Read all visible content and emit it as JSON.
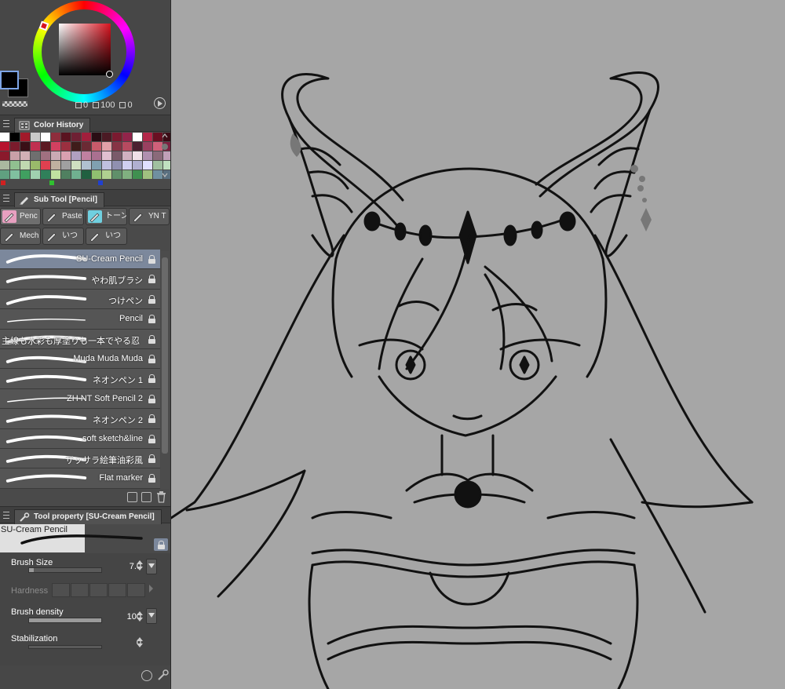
{
  "color": {
    "readout": {
      "h_label": "H",
      "h_value": "0",
      "s_label": "S",
      "s_value": "100",
      "v_label": "V",
      "v_value": "0"
    },
    "accent": "#7c889c"
  },
  "color_history": {
    "tab_label": "Color History",
    "rows": [
      [
        "#ffffff",
        "#000000",
        "#a21a2a",
        "#c9c9c9",
        "#ffffff",
        "#8e2d3c",
        "#5a1320",
        "#6e2033",
        "#a11f3c",
        "#2a0d14",
        "#4b1a24",
        "#7b1a30",
        "#92244a",
        "#ffffff",
        "#b32749",
        "#6a0f22",
        "#3c0c16"
      ],
      [
        "#b7132e",
        "#7a1b2c",
        "#3a0f16",
        "#c03050",
        "#5c1a22",
        "#d24060",
        "#9b2f3f",
        "#3f1c1a",
        "#6b2a34",
        "#c85a6a",
        "#e2a0a8",
        "#873345",
        "#b74a60",
        "#4c2030",
        "#9a4060",
        "#d0607a",
        "#7d2040"
      ],
      [
        "#8a1a2c",
        "#c9a0a8",
        "#d1b0b5",
        "#6f6f6f",
        "#a07080",
        "#caaab4",
        "#d9a0b0",
        "#b0a0c0",
        "#c080a0",
        "#aa7090",
        "#e0c0d0",
        "#7a5a6a",
        "#d0b0c0",
        "#f0e0e8",
        "#b090b0",
        "#8a6a7a",
        "#c0a0b8"
      ],
      [
        "#aab8a0",
        "#90c090",
        "#c0d8b0",
        "#9aba6a",
        "#e04050",
        "#c0b0a0",
        "#a0a0a0",
        "#d0e0c0",
        "#b0c0d0",
        "#80a0b0",
        "#c0c0e0",
        "#9090b0",
        "#d0d0f0",
        "#b0b0d0",
        "#e0e0ff",
        "#a0c0a0",
        "#c0e0c0"
      ],
      [
        "#60a080",
        "#80c0a0",
        "#40a060",
        "#a0d0b0",
        "#30805a",
        "#c0e0a0",
        "#508060",
        "#70b090",
        "#206040",
        "#90c070",
        "#b0d090",
        "#60906a",
        "#80b080",
        "#409050",
        "#a0c080",
        "#7090a0",
        "#5a7080"
      ]
    ],
    "strip": [
      "#d02020",
      "#4a4a4a",
      "#30c030",
      "#4a4a4a",
      "#2040d0",
      "#4a4a4a"
    ]
  },
  "sub_tool": {
    "tab_label": "Sub Tool [Pencil]",
    "buttons_row1": [
      {
        "label": "Penc",
        "icon": "pencil-icon",
        "color": "#e8a0c0"
      },
      {
        "label": "Paste",
        "icon": "pastel-icon",
        "color": "#5a5a5a"
      },
      {
        "label": "トーン",
        "icon": "tone-icon",
        "color": "#70d0e0"
      },
      {
        "label": "YN T",
        "icon": "pen-nib-icon",
        "color": "#5a5a5a"
      }
    ],
    "buttons_row2": [
      {
        "label": "Mech",
        "icon": "mechanical-pencil-icon",
        "color": "#5a5a5a"
      },
      {
        "label": "いつ",
        "icon": "pencil-icon",
        "color": "#5a5a5a"
      },
      {
        "label": "いつ",
        "icon": "pencil-icon",
        "color": "#5a5a5a"
      }
    ],
    "brushes": [
      {
        "label": "SU-Cream Pencil",
        "selected": true
      },
      {
        "label": "やわ肌ブラシ",
        "selected": false
      },
      {
        "label": "つけペン",
        "selected": false
      },
      {
        "label": "Pencil",
        "selected": false
      },
      {
        "label": "主線も水彩も厚塗りも一本でやる忍",
        "selected": false
      },
      {
        "label": "Muda Muda Muda",
        "selected": false
      },
      {
        "label": "ネオンペン 1",
        "selected": false
      },
      {
        "label": "ZH NT Soft Pencil 2",
        "selected": false
      },
      {
        "label": "ネオンペン 2",
        "selected": false
      },
      {
        "label": "soft sketch&line",
        "selected": false
      },
      {
        "label": "ザッサラ絵筆油彩風",
        "selected": false
      },
      {
        "label": "Flat marker",
        "selected": false
      }
    ]
  },
  "tool_property": {
    "tab_label": "Tool property [SU-Cream Pencil]",
    "preview_label": "SU-Cream Pencil",
    "brush_size": {
      "label": "Brush Size",
      "value": "7.0",
      "fraction": 0.07
    },
    "hardness": {
      "label": "Hardness"
    },
    "brush_density": {
      "label": "Brush density",
      "value": "100",
      "fraction": 1.0
    },
    "stabilization": {
      "label": "Stabilization",
      "value": "0",
      "fraction": 0.0
    }
  }
}
